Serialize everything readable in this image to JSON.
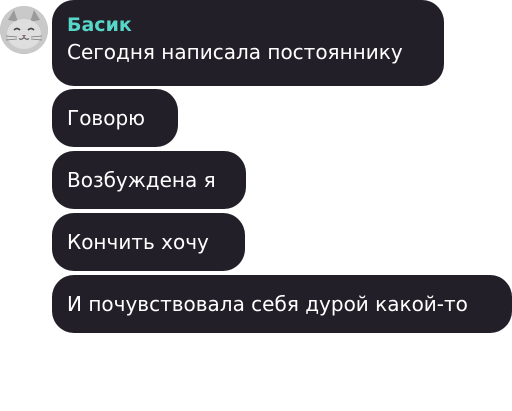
{
  "sender": {
    "name": "Басик",
    "name_color": "#57d7c9",
    "avatar_icon": "cat-avatar-icon"
  },
  "bubble_color": "#221f29",
  "messages": [
    "Сегодня написала постояннику",
    "Говорю",
    "Возбуждена я",
    "Кончить хочу",
    "И почувствовала себя дурой какой-то"
  ]
}
